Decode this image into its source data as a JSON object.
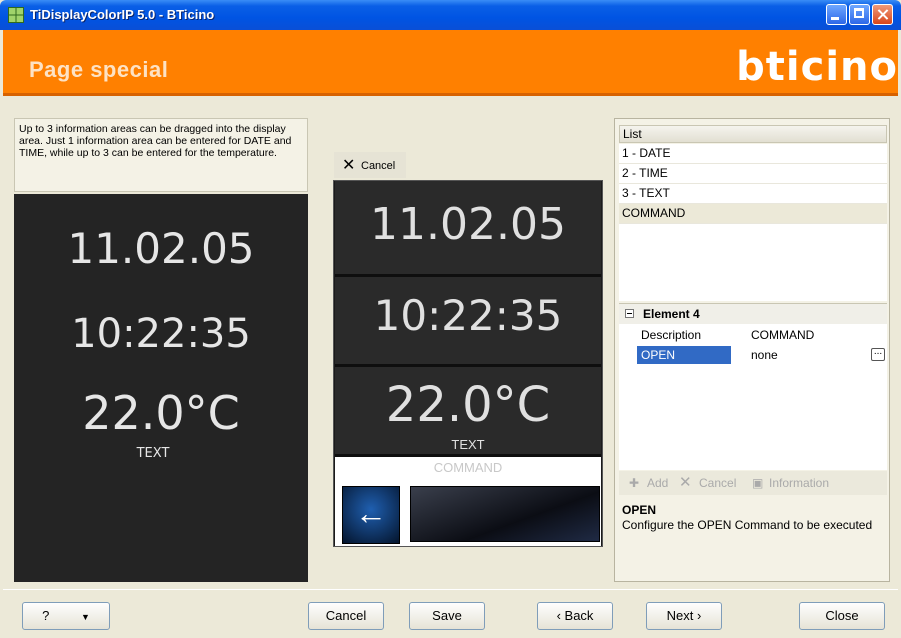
{
  "window": {
    "title": "TiDisplayColorIP 5.0 - BTicino"
  },
  "header": {
    "page_title": "Page special",
    "logo": "bticino"
  },
  "description": "Up to 3 information areas can be dragged into the display area. Just 1 information area can be entered for DATE and TIME, while up to 3 can be entered for the temperature.",
  "display_left": {
    "date": "11.02.05",
    "time": "10:22:35",
    "temp": "22.0°C",
    "text": "TEXT"
  },
  "cancel_label": "Cancel",
  "display_mid": {
    "date": "11.02.05",
    "time": "10:22:35",
    "temp": "22.0°C",
    "text": "TEXT",
    "command": "COMMAND"
  },
  "list": {
    "header": "List",
    "items": [
      "1 - DATE",
      "2 - TIME",
      "3 - TEXT",
      "COMMAND"
    ],
    "selected_index": 3
  },
  "properties": {
    "group": "Element 4",
    "rows": [
      {
        "key": "Description",
        "value": "COMMAND"
      },
      {
        "key": "OPEN",
        "value": "none"
      }
    ],
    "ellipsis": "..."
  },
  "toolbar": {
    "add": "Add",
    "cancel": "Cancel",
    "information": "Information"
  },
  "help": {
    "title": "OPEN",
    "text": "Configure the OPEN Command to be executed"
  },
  "buttons": {
    "help": "?",
    "cancel": "Cancel",
    "save": "Save",
    "back": "‹ Back",
    "next": "Next ›",
    "close": "Close"
  },
  "colors": {
    "accent": "#ff8000",
    "selection": "#316ac5",
    "display_bg": "#242424"
  }
}
